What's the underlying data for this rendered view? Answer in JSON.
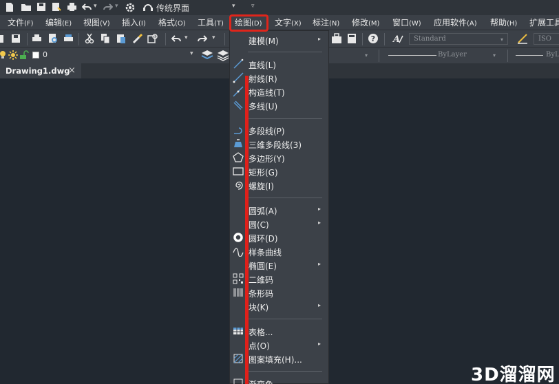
{
  "qat": {
    "workspace_name": "传统界面",
    "workspace_arrow": "▾",
    "more_arrow": "▿"
  },
  "menubar": {
    "items": [
      {
        "label": "文件",
        "key": "(F)"
      },
      {
        "label": "编辑",
        "key": "(E)"
      },
      {
        "label": "视图",
        "key": "(V)"
      },
      {
        "label": "插入",
        "key": "(I)"
      },
      {
        "label": "格式",
        "key": "(O)"
      },
      {
        "label": "工具",
        "key": "(T)"
      },
      {
        "label": "绘图",
        "key": "(D)"
      },
      {
        "label": "文字",
        "key": "(X)"
      },
      {
        "label": "标注",
        "key": "(N)"
      },
      {
        "label": "修改",
        "key": "(M)"
      },
      {
        "label": "窗口",
        "key": "(W)"
      },
      {
        "label": "应用软件",
        "key": "(A)"
      },
      {
        "label": "帮助",
        "key": "(H)"
      },
      {
        "label": "扩展工具",
        "key": ""
      }
    ]
  },
  "toolbar": {
    "text_style": "Standard",
    "iso_label": "ISO",
    "layer_name": "0",
    "linetype": "ByLayer",
    "lineweight": "ByLayer",
    "lineweight_short": "ByL"
  },
  "document_tab": {
    "name": "Drawing1.dwg",
    "close": "×"
  },
  "draw_menu": {
    "items": [
      {
        "label": "建模(M)",
        "submenu": true,
        "icon": ""
      },
      {
        "label": "直线(L)",
        "submenu": false,
        "icon": "line-icon"
      },
      {
        "label": "射线(R)",
        "submenu": false,
        "icon": "ray-icon"
      },
      {
        "label": "构造线(T)",
        "submenu": false,
        "icon": "construction-line-icon"
      },
      {
        "label": "多线(U)",
        "submenu": false,
        "icon": "multiline-icon"
      },
      {
        "label": "多段线(P)",
        "submenu": false,
        "icon": "polyline-icon"
      },
      {
        "label": "三维多段线(3)",
        "submenu": false,
        "icon": "3d-polyline-icon"
      },
      {
        "label": "多边形(Y)",
        "submenu": false,
        "icon": "polygon-icon"
      },
      {
        "label": "矩形(G)",
        "submenu": false,
        "icon": "rectangle-icon"
      },
      {
        "label": "螺旋(I)",
        "submenu": false,
        "icon": "helix-icon"
      },
      {
        "label": "圆弧(A)",
        "submenu": true,
        "icon": ""
      },
      {
        "label": "圆(C)",
        "submenu": true,
        "icon": ""
      },
      {
        "label": "圆环(D)",
        "submenu": false,
        "icon": "donut-icon"
      },
      {
        "label": "样条曲线",
        "submenu": false,
        "icon": "spline-icon"
      },
      {
        "label": "椭圆(E)",
        "submenu": true,
        "icon": ""
      },
      {
        "label": "二维码",
        "submenu": false,
        "icon": "qr-code-icon"
      },
      {
        "label": "条形码",
        "submenu": false,
        "icon": "barcode-icon"
      },
      {
        "label": "块(K)",
        "submenu": true,
        "icon": ""
      },
      {
        "label": "表格...",
        "submenu": false,
        "icon": "table-icon"
      },
      {
        "label": "点(O)",
        "submenu": true,
        "icon": ""
      },
      {
        "label": "图案填充(H)...",
        "submenu": false,
        "icon": "hatch-icon"
      },
      {
        "label": "渐变色",
        "submenu": false,
        "icon": "gradient-icon"
      }
    ],
    "submenu_arrow": "▸"
  },
  "watermark": "3D溜溜网",
  "colors": {
    "highlight_red": "#e0251b",
    "menu_bg": "#3c4148",
    "canvas_bg": "#212830",
    "accent_blue": "#5b9bd5"
  }
}
